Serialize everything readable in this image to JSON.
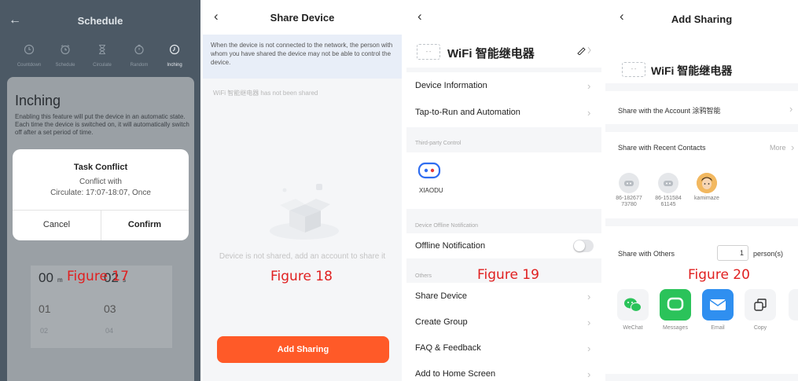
{
  "figures": [
    "Figure 17",
    "Figure 18",
    "Figure 19",
    "Figure 20"
  ],
  "panel1": {
    "title": "Schedule",
    "modes": [
      {
        "label": "Countdown",
        "icon": "clock-icon"
      },
      {
        "label": "Schedule",
        "icon": "alarm-icon"
      },
      {
        "label": "Circulate",
        "icon": "hourglass-icon"
      },
      {
        "label": "Random",
        "icon": "random-icon"
      },
      {
        "label": "Inching",
        "icon": "timer-icon"
      }
    ],
    "heading": "Inching",
    "description": "Enabling this feature will put the device in an automatic state. Each time the device is switched on, it will automatically switch off after a set period of time.",
    "picker": {
      "min_values": [
        "00",
        "01",
        "02"
      ],
      "sec_values": [
        "02",
        "03",
        "04"
      ],
      "min_unit": "m",
      "sec_unit": "s"
    },
    "dialog": {
      "title": "Task Conflict",
      "line1": "Conflict with",
      "line2": "Circulate: 17:07-18:07, Once",
      "cancel": "Cancel",
      "confirm": "Confirm"
    }
  },
  "panel2": {
    "title": "Share Device",
    "notice": "When the device is not connected to the network, the person with whom you have shared the device may not be able to control the device.",
    "not_shared": "WiFi 智能继电器 has not been shared",
    "empty_text": "Device is not shared, add an account to share it",
    "add_button": "Add Sharing",
    "accent": "#ff5a28"
  },
  "panel3": {
    "device_name": "WiFi 智能继电器",
    "items1": [
      "Device Information",
      "Tap-to-Run and Automation"
    ],
    "third_party_title": "Third-party Control",
    "third_party_name": "XIAODU",
    "offline_title": "Device Offline Notification",
    "offline_item": "Offline Notification",
    "offline_enabled": false,
    "others_title": "Others",
    "items2": [
      "Share Device",
      "Create Group",
      "FAQ & Feedback",
      "Add to Home Screen"
    ]
  },
  "panel4": {
    "title": "Add Sharing",
    "device_name": "WiFi 智能继电器",
    "share_account": "Share with the Account 涂鸦智能",
    "recent_title": "Share with Recent Contacts",
    "more": "More",
    "contacts": [
      {
        "line1": "86-182677",
        "line2": "73780"
      },
      {
        "line1": "86-151584",
        "line2": "61145"
      },
      {
        "line1": "kamimaze",
        "line2": ""
      }
    ],
    "others_label": "Share with Others",
    "count": "1",
    "count_unit": "person(s)",
    "share_options": [
      {
        "label": "WeChat",
        "icon": "wechat-icon",
        "color": "#2bc35a"
      },
      {
        "label": "Messages",
        "icon": "messages-icon",
        "color": "#2bc35a"
      },
      {
        "label": "Email",
        "icon": "email-icon",
        "color": "#2f8ff0"
      },
      {
        "label": "Copy",
        "icon": "copy-icon",
        "color": "#ffffff"
      }
    ]
  }
}
